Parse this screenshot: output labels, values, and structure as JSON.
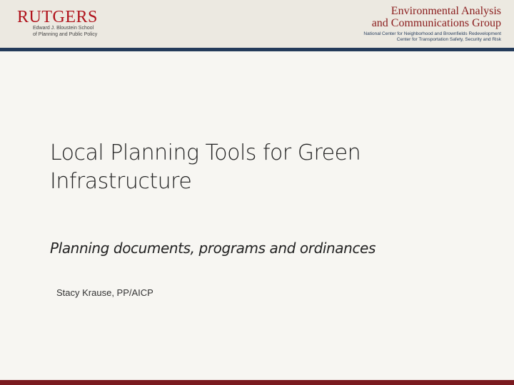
{
  "header": {
    "logo_word": "RUTGERS",
    "school_line1": "Edward J. Bloustein School",
    "school_line2": "of Planning and Public Policy",
    "group_line1": "Environmental Analysis",
    "group_line2": "and Communications Group",
    "center_line1": "National Center for Neighborhood and Brownfields Redevelopment",
    "center_line2": "Center for Transportation Safety, Security and Risk"
  },
  "slide": {
    "title": "Local Planning Tools for Green Infrastructure",
    "subtitle": "Planning documents, programs and ordinances",
    "author": "Stacy Krause, PP/AICP"
  },
  "colors": {
    "rutgers_red": "#b0121b",
    "header_rule": "#243b5a",
    "footer_bar": "#7a1a1f",
    "background": "#f7f6f2"
  }
}
